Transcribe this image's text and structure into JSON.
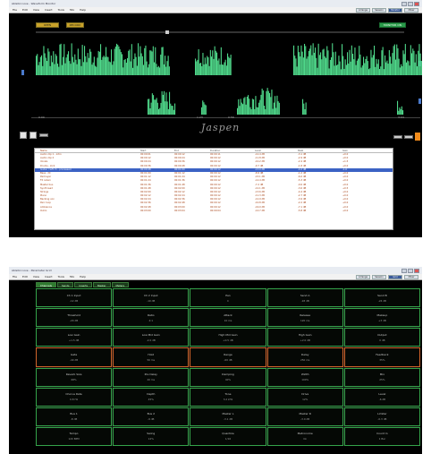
{
  "screen1": {
    "title": "Ableton Live - Waveform Monitor",
    "menu": [
      "File",
      "Edit",
      "View",
      "Insert",
      "Tools",
      "Mix",
      "Help"
    ],
    "mode_tabs": [
      "Arrange",
      "Session",
      "Monitor",
      "Mixer"
    ],
    "active_mode_tab": "Monitor",
    "toolbar_buttons": [
      "OPEN",
      "RECORD"
    ],
    "status_button": "MONITOR ON",
    "timeline_labels": [
      "0:00",
      "1:23",
      "0:56",
      "3:04"
    ],
    "signature_text": "Jaspen",
    "table": {
      "columns": [
        "Name",
        "Start",
        "End",
        "Duration",
        "Level",
        "Peak",
        "Gain"
      ],
      "rows": [
        [
          "Audio clip 1 - intro",
          "00:00:01",
          "00:00:12",
          "00:00:11",
          "-12.4 dB",
          "-3.1 dB",
          "+0.0"
        ],
        [
          "Audio clip 2",
          "00:00:12",
          "00:00:24",
          "00:00:12",
          "-11.8 dB",
          "-2.9 dB",
          "+0.0"
        ],
        [
          "Vocals",
          "00:00:24",
          "00:00:36",
          "00:00:12",
          "-10.2 dB",
          "-2.4 dB",
          "+1.5"
        ],
        [
          "Drums - kick",
          "00:00:36",
          "00:00:48",
          "00:00:12",
          "-9.7 dB",
          "-1.8 dB",
          "+0.0"
        ],
        [
          "Guitar / left ch - processed",
          "00:00:48",
          "00:01:00",
          "00:00:12",
          "-13.0 dB",
          "-4.2 dB",
          "-1.0"
        ],
        [
          "Bass - DI",
          "00:01:00",
          "00:01:12",
          "00:00:12",
          "-8.9 dB",
          "-1.2 dB",
          "+0.0"
        ],
        [
          "Pad layer",
          "00:01:12",
          "00:01:24",
          "00:00:12",
          "-15.1 dB",
          "-6.0 dB",
          "+0.0"
        ],
        [
          "FX return",
          "00:01:24",
          "00:01:36",
          "00:00:12",
          "-14.4 dB",
          "-5.3 dB",
          "+0.0"
        ],
        [
          "Master bus",
          "00:01:36",
          "00:01:48",
          "00:00:12",
          "-7.2 dB",
          "-0.6 dB",
          "+0.0"
        ],
        [
          "Synth lead",
          "00:01:48",
          "00:02:00",
          "00:00:12",
          "-12.1 dB",
          "-3.6 dB",
          "+0.5"
        ],
        [
          "Strings",
          "00:02:00",
          "00:02:12",
          "00:00:12",
          "-13.6 dB",
          "-4.4 dB",
          "+0.0"
        ],
        [
          "Piano",
          "00:02:12",
          "00:02:24",
          "00:00:12",
          "-11.3 dB",
          "-2.7 dB",
          "+0.0"
        ],
        [
          "Backing vox",
          "00:02:24",
          "00:02:36",
          "00:00:12",
          "-12.9 dB",
          "-3.9 dB",
          "+0.0"
        ],
        [
          "Perc loop",
          "00:02:36",
          "00:02:48",
          "00:00:12",
          "-10.8 dB",
          "-2.2 dB",
          "+0.0"
        ],
        [
          "Ambience",
          "00:02:48",
          "00:03:00",
          "00:00:12",
          "-16.0 dB",
          "-7.1 dB",
          "+0.0"
        ],
        [
          "Outro",
          "00:03:00",
          "00:03:04",
          "00:00:04",
          "-14.7 dB",
          "-5.8 dB",
          "+0.0"
        ]
      ],
      "selected_row": 4
    }
  },
  "screen2": {
    "title": "Ableton Live - Parameter Grid",
    "menu": [
      "File",
      "Edit",
      "View",
      "Insert",
      "Tools",
      "Mix",
      "Help"
    ],
    "mode_tabs": [
      "Arrange",
      "Session",
      "Grid",
      "Mixer"
    ],
    "active_mode_tab": "Grid",
    "grid_tabs": [
      "Channels",
      "Sends",
      "Inserts",
      "Master",
      "Meters"
    ],
    "active_grid_tab": "Channels",
    "cells": [
      [
        "Ch 1 Input",
        "-12 dB"
      ],
      [
        "Ch 2 Input",
        "-10 dB"
      ],
      [
        "Pan",
        "C"
      ],
      [
        "Send A",
        "-18 dB"
      ],
      [
        "Send B",
        "-24 dB"
      ],
      [
        "Threshold",
        "-20 dB"
      ],
      [
        "Ratio",
        "4:1"
      ],
      [
        "Attack",
        "10 ms"
      ],
      [
        "Release",
        "120 ms"
      ],
      [
        "Makeup",
        "+3 dB"
      ],
      [
        "Low Gain",
        "+1.5 dB"
      ],
      [
        "Low Mid Gain",
        "-2.0 dB"
      ],
      [
        "High Mid Gain",
        "+0.5 dB"
      ],
      [
        "High Gain",
        "+2.0 dB"
      ],
      [
        "Output",
        "0 dB"
      ],
      [
        "Gate",
        "-40 dB"
      ],
      [
        "Hold",
        "50 ms"
      ],
      [
        "Range",
        "-60 dB"
      ],
      [
        "Delay",
        "250 ms"
      ],
      [
        "Feedback",
        "35%"
      ],
      [
        "Reverb Size",
        "68%"
      ],
      [
        "Pre Delay",
        "20 ms"
      ],
      [
        "Damping",
        "40%"
      ],
      [
        "Width",
        "100%"
      ],
      [
        "Mix",
        "25%"
      ],
      [
        "Chorus Rate",
        "0.8 Hz"
      ],
      [
        "Depth",
        "45%"
      ],
      [
        "Tone",
        "3.2 kHz"
      ],
      [
        "Drive",
        "12%"
      ],
      [
        "Level",
        "-6 dB"
      ],
      [
        "Bus 1",
        "-8 dB"
      ],
      [
        "Bus 2",
        "-9 dB"
      ],
      [
        "Master L",
        "-3.1 dB"
      ],
      [
        "Master R",
        "-3.0 dB"
      ],
      [
        "Limiter",
        "-0.3 dB"
      ],
      [
        "Tempo",
        "120 BPM"
      ],
      [
        "Swing",
        "12%"
      ],
      [
        "Quantize",
        "1/16"
      ],
      [
        "Metronome",
        "On"
      ],
      [
        "Count In",
        "1 Bar"
      ]
    ],
    "orange_row": 3
  },
  "colors": {
    "waveform": "#4fd88a",
    "panel_bg": "#000000",
    "grid_border": "#34a34a",
    "grid_border_alert": "#d2642a",
    "selection": "#3b62c4",
    "accent_orange": "#f08a1a"
  }
}
